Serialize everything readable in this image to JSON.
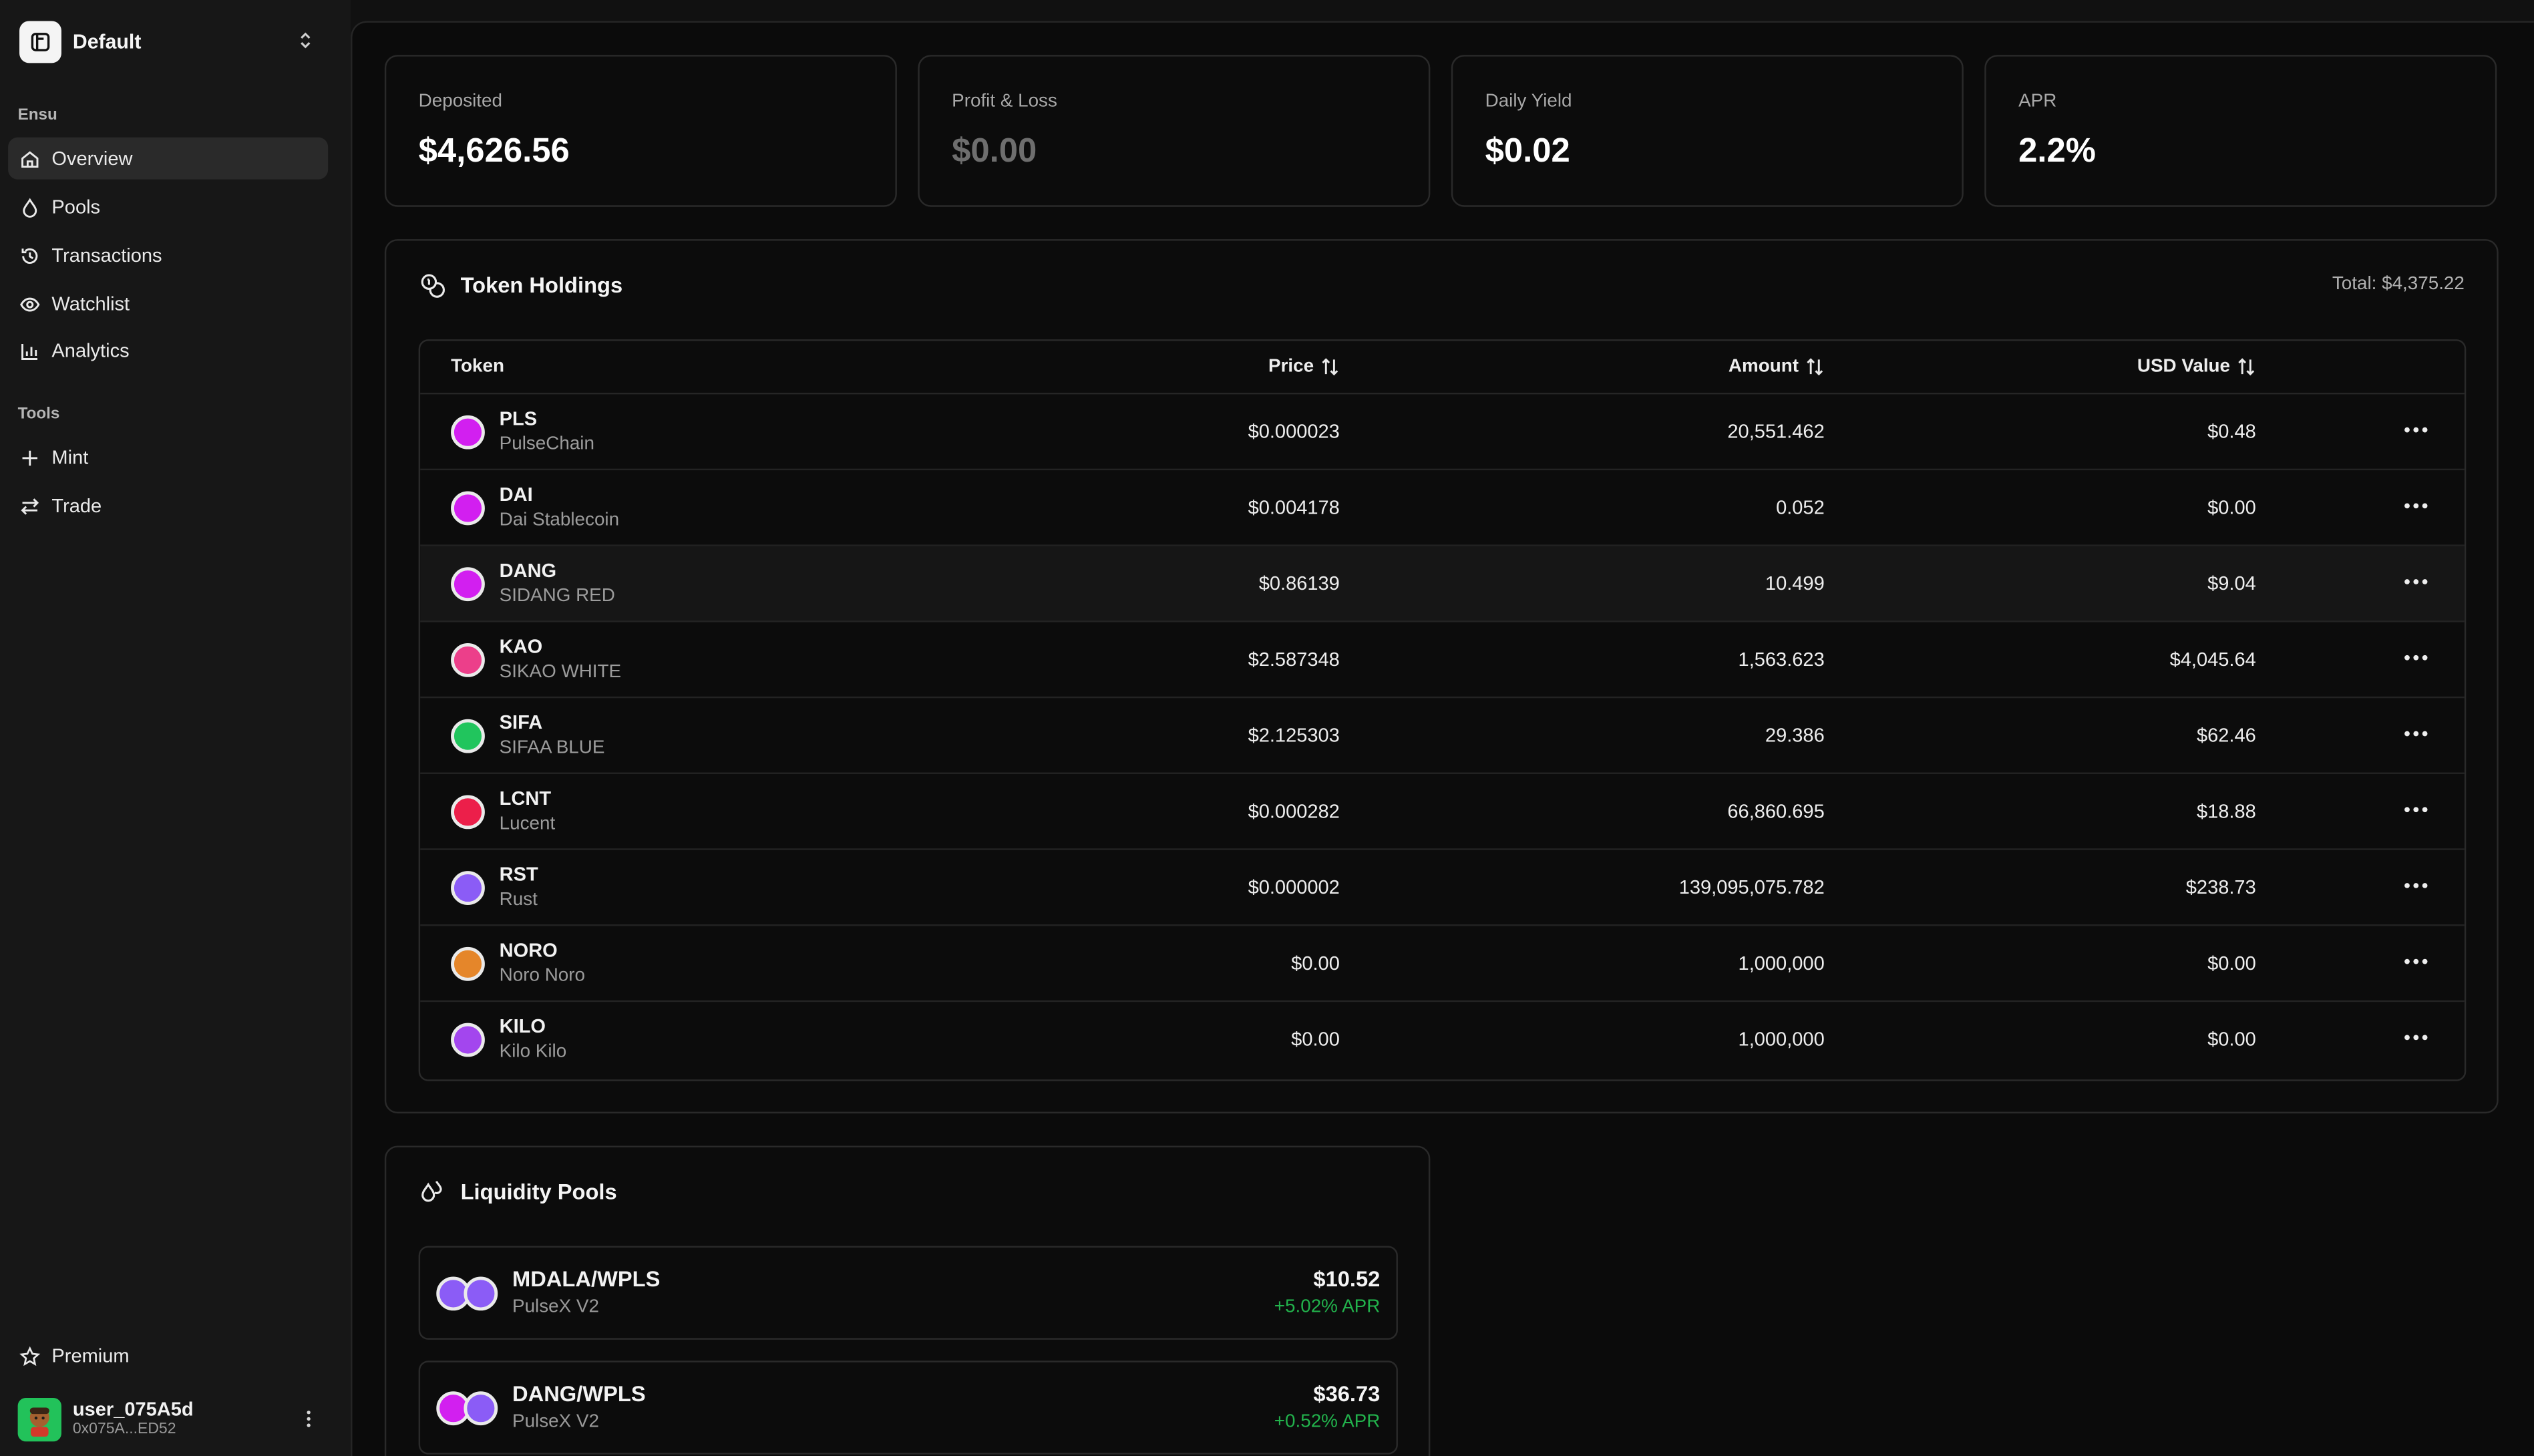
{
  "workspace": {
    "name": "Default"
  },
  "sidebar": {
    "group_main": "Ensu",
    "items": [
      {
        "label": "Overview",
        "icon": "home-icon"
      },
      {
        "label": "Pools",
        "icon": "droplet-icon"
      },
      {
        "label": "Transactions",
        "icon": "history-icon"
      },
      {
        "label": "Watchlist",
        "icon": "eye-icon"
      },
      {
        "label": "Analytics",
        "icon": "bar-chart-icon"
      }
    ],
    "group_tools": "Tools",
    "tools": [
      {
        "label": "Mint",
        "icon": "plus-icon"
      },
      {
        "label": "Trade",
        "icon": "swap-icon"
      }
    ],
    "premium": "Premium",
    "user": {
      "name": "user_075A5d",
      "address": "0x075A...ED52"
    }
  },
  "stats": [
    {
      "label": "Deposited",
      "value": "$4,626.56"
    },
    {
      "label": "Profit & Loss",
      "value": "$0.00"
    },
    {
      "label": "Daily Yield",
      "value": "$0.02"
    },
    {
      "label": "APR",
      "value": "2.2%"
    }
  ],
  "holdings": {
    "title": "Token Holdings",
    "total": "Total: $4,375.22",
    "columns": {
      "token": "Token",
      "price": "Price",
      "amount": "Amount",
      "usd": "USD Value"
    },
    "rows": [
      {
        "symbol": "PLS",
        "name": "PulseChain",
        "price": "$0.000023",
        "amount": "20,551.462",
        "usd": "$0.48",
        "color": "#d21ff0"
      },
      {
        "symbol": "DAI",
        "name": "Dai Stablecoin",
        "price": "$0.004178",
        "amount": "0.052",
        "usd": "$0.00",
        "color": "#d21ff0"
      },
      {
        "symbol": "DANG",
        "name": "SIDANG RED",
        "price": "$0.86139",
        "amount": "10.499",
        "usd": "$9.04",
        "color": "#d21ff0"
      },
      {
        "symbol": "KAO",
        "name": "SIKAO WHITE",
        "price": "$2.587348",
        "amount": "1,563.623",
        "usd": "$4,045.64",
        "color": "#ec3f8a"
      },
      {
        "symbol": "SIFA",
        "name": "SIFAA BLUE",
        "price": "$2.125303",
        "amount": "29.386",
        "usd": "$62.46",
        "color": "#21c55d"
      },
      {
        "symbol": "LCNT",
        "name": "Lucent",
        "price": "$0.000282",
        "amount": "66,860.695",
        "usd": "$18.88",
        "color": "#ec1f4a"
      },
      {
        "symbol": "RST",
        "name": "Rust",
        "price": "$0.000002",
        "amount": "139,095,075.782",
        "usd": "$238.73",
        "color": "#8b5cf6"
      },
      {
        "symbol": "NORO",
        "name": "Noro Noro",
        "price": "$0.00",
        "amount": "1,000,000",
        "usd": "$0.00",
        "color": "#e5862a"
      },
      {
        "symbol": "KILO",
        "name": "Kilo Kilo",
        "price": "$0.00",
        "amount": "1,000,000",
        "usd": "$0.00",
        "color": "#a346ee"
      }
    ]
  },
  "pools": {
    "title": "Liquidity Pools",
    "items": [
      {
        "pair": "MDALA/WPLS",
        "dex": "PulseX V2",
        "value": "$10.52",
        "apr": "+5.02% APR",
        "color_a": "#8b5cf6",
        "color_b": "#8b5cf6"
      },
      {
        "pair": "DANG/WPLS",
        "dex": "PulseX V2",
        "value": "$36.73",
        "apr": "+0.52% APR",
        "color_a": "#d21ff0",
        "color_b": "#8b5cf6"
      }
    ]
  },
  "colors": {
    "accent_green": "#22b24c",
    "background": "#0b0b0b",
    "sidebar": "#171717"
  }
}
